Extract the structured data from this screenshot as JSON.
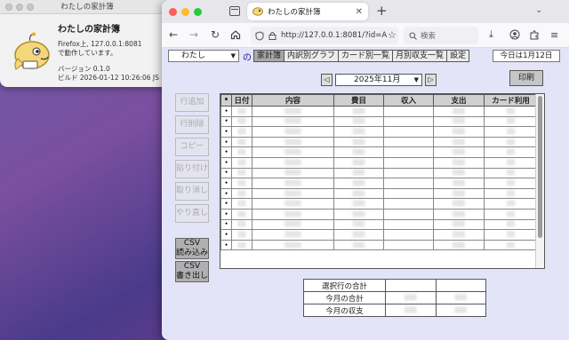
{
  "about": {
    "window_title": "わたしの家計簿",
    "app_name": "わたしの家計簿",
    "line1": "Firefox上, 127.0.0.1:8081",
    "line2": "で動作しています。",
    "version": "バージョン 0.1.0",
    "build": "ビルド 2026-01-12 10:26:06 JS"
  },
  "browser": {
    "tab_title": "わたしの家計簿",
    "url": "http://127.0.0.1:8081/?id=A",
    "search_placeholder": "検索"
  },
  "app": {
    "user_select": "わたし",
    "no_label": "の",
    "menu_tabs": [
      "家計簿",
      "内訳別グラフ",
      "カード別一覧",
      "月別収支一覧",
      "設定"
    ],
    "today": "今日は1月12日",
    "month": "2025年11月",
    "prev": "◁",
    "next": "▷",
    "print": "印刷",
    "side_buttons": [
      "行追加",
      "行削除",
      "コピー",
      "貼り付け",
      "取り消し",
      "やり直し"
    ],
    "csv_import": [
      "CSV",
      "読み込み"
    ],
    "csv_export": [
      "CSV",
      "書き出し"
    ],
    "columns": [
      "•",
      "日付",
      "内容",
      "費目",
      "収入",
      "支出",
      "カード利用"
    ],
    "row_marker": "•",
    "summary": {
      "selected_total": "選択行の合計",
      "month_total": "今月の合計",
      "month_balance": "今月の収支"
    }
  },
  "colors": {
    "page_bg": "#e4e4f8",
    "accent_text": "#1a1aa0",
    "active_tab": "#a7a7a7"
  }
}
